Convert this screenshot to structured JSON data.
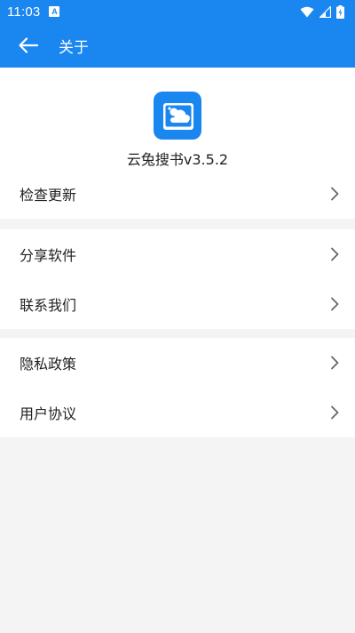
{
  "status_bar": {
    "time": "11:03",
    "badge": "A"
  },
  "app_bar": {
    "title": "关于"
  },
  "about": {
    "app_name_version": "云兔搜书v3.5.2"
  },
  "groups": [
    {
      "items": [
        {
          "label": "检查更新"
        }
      ]
    },
    {
      "items": [
        {
          "label": "分享软件"
        },
        {
          "label": "联系我们"
        }
      ]
    },
    {
      "items": [
        {
          "label": "隐私政策"
        },
        {
          "label": "用户协议"
        }
      ]
    }
  ],
  "colors": {
    "primary": "#1a86f0",
    "background": "#f4f4f4",
    "card": "#ffffff"
  }
}
